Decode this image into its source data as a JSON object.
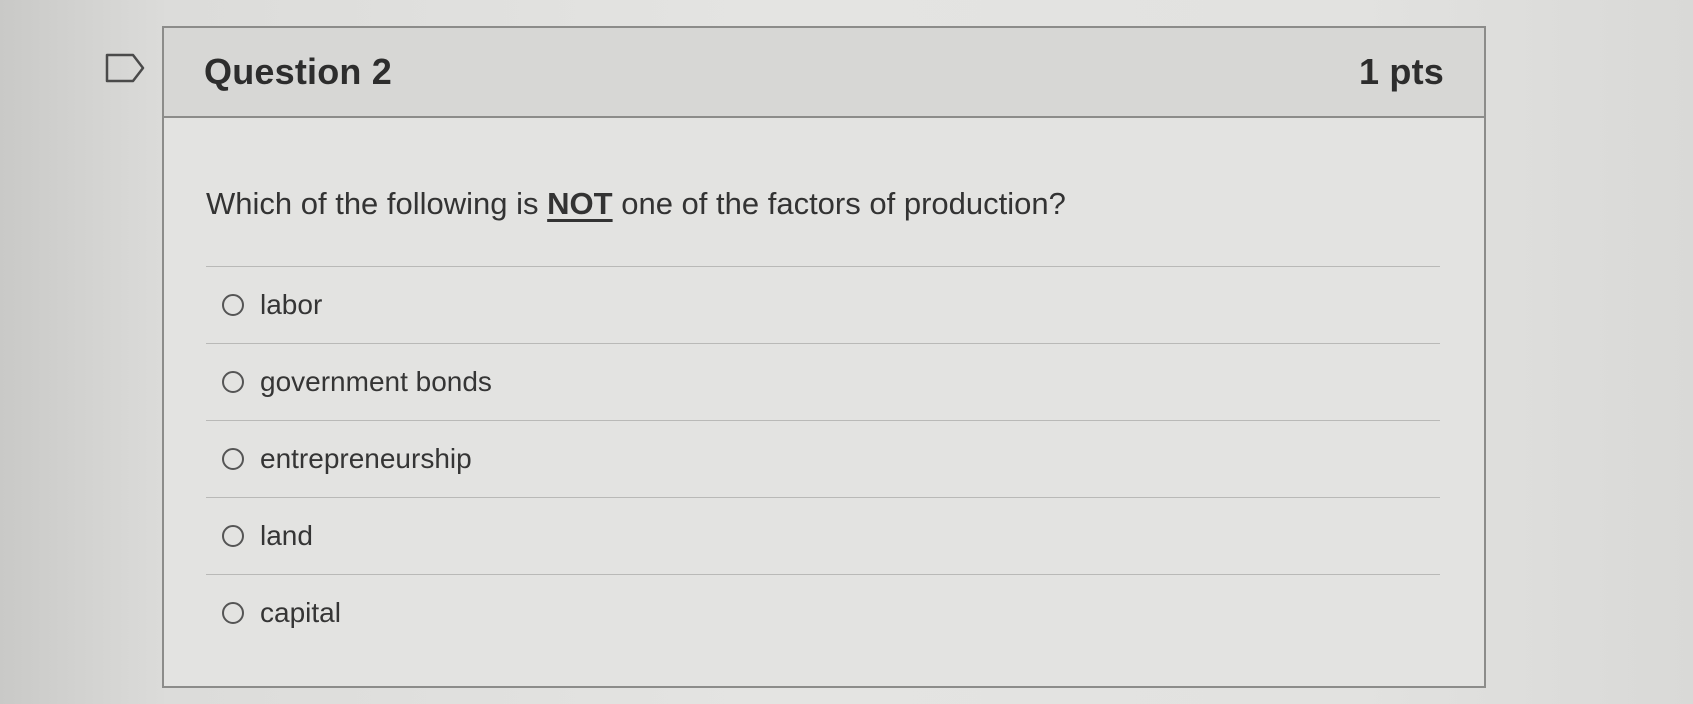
{
  "question": {
    "title": "Question 2",
    "points": "1 pts",
    "text_before": "Which of the following is ",
    "text_emphasis": "NOT",
    "text_after": " one of the factors of production?",
    "flag_icon": "flag-icon"
  },
  "answers": [
    {
      "label": "labor"
    },
    {
      "label": "government bonds"
    },
    {
      "label": "entrepreneurship"
    },
    {
      "label": "land"
    },
    {
      "label": "capital"
    }
  ],
  "colors": {
    "border": "#8c8c8a",
    "header_bg": "#d7d7d5",
    "text": "#2d2d2d"
  }
}
